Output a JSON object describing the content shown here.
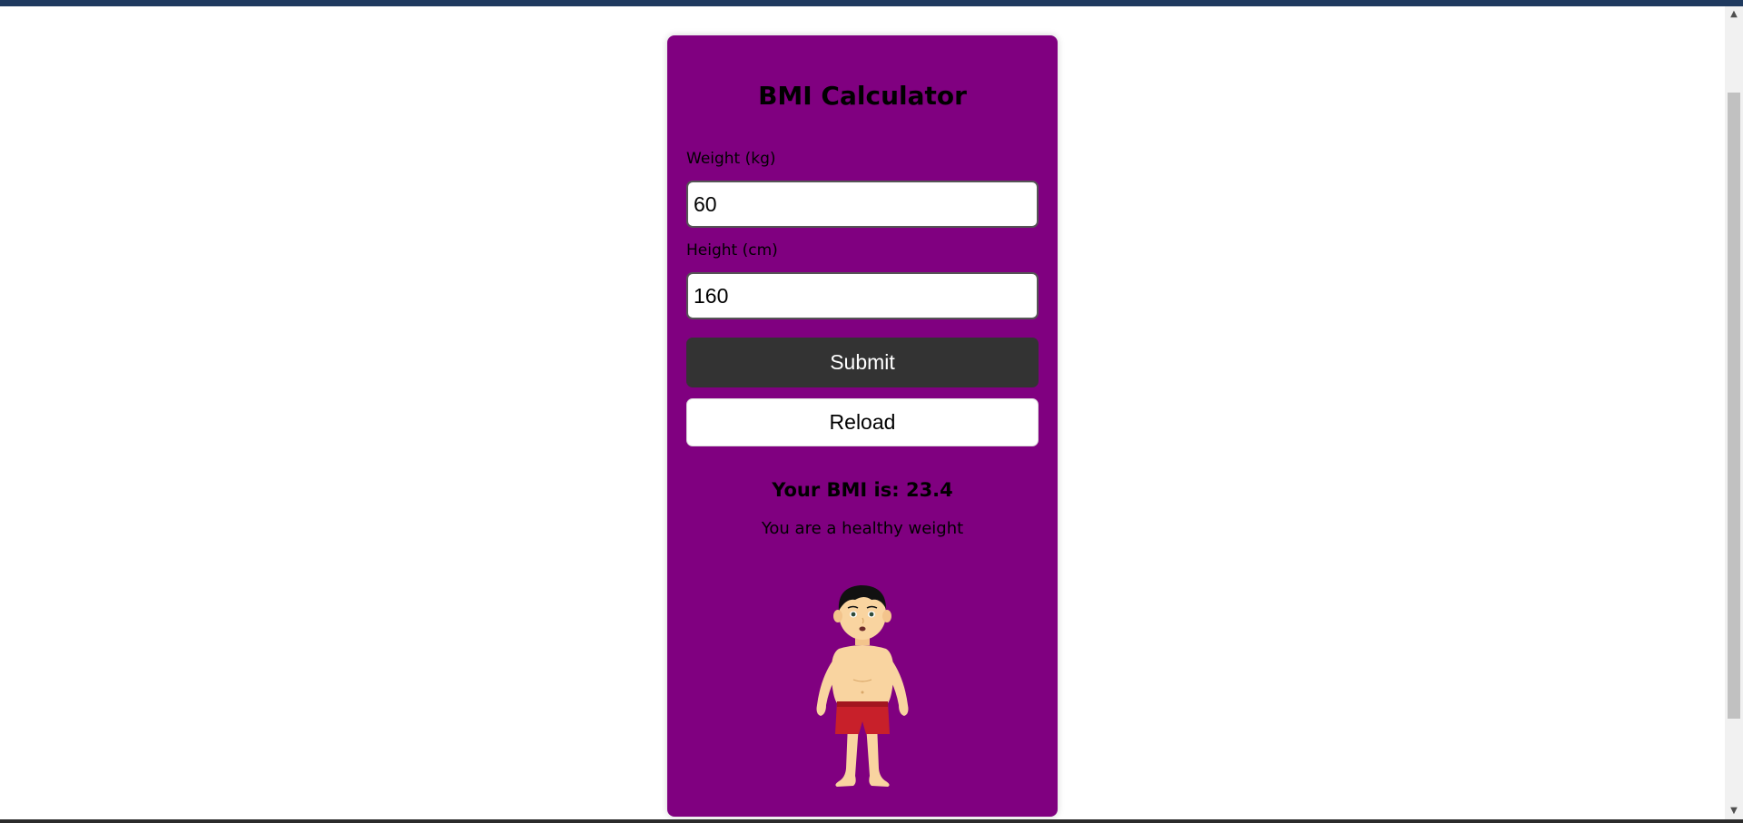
{
  "app": {
    "title": "BMI Calculator"
  },
  "form": {
    "weight_label": "Weight (kg)",
    "weight_value": "60",
    "height_label": "Height (cm)",
    "height_value": "160",
    "submit_label": "Submit",
    "reload_label": "Reload"
  },
  "result": {
    "bmi_text": "Your BMI is: 23.4",
    "message": "You are a healthy weight"
  },
  "illustration": {
    "icon": "healthy-weight-person-icon"
  },
  "colors": {
    "card_background": "#800080",
    "submit_background": "#333333",
    "top_bar": "#1f3a5f",
    "shorts": "#c8202a",
    "skin": "#f9d4a0"
  }
}
